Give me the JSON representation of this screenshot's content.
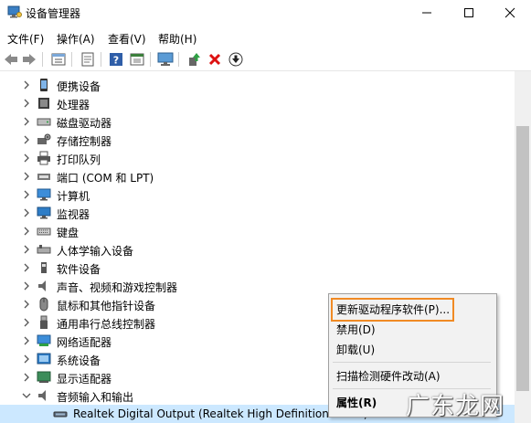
{
  "window": {
    "title": "设备管理器"
  },
  "menu": [
    "文件(F)",
    "操作(A)",
    "查看(V)",
    "帮助(H)"
  ],
  "toolbar_icons": [
    "back-icon",
    "forward-icon",
    "properties-icon",
    "show-hidden-icon",
    "help-icon",
    "view-icon",
    "scan-monitor-icon",
    "update-driver-icon",
    "uninstall-icon",
    "disable-icon"
  ],
  "tree": {
    "items": [
      "便携设备",
      "处理器",
      "磁盘驱动器",
      "存储控制器",
      "打印队列",
      "端口 (COM 和 LPT)",
      "计算机",
      "监视器",
      "键盘",
      "人体学输入设备",
      "软件设备",
      "声音、视频和游戏控制器",
      "鼠标和其他指针设备",
      "通用串行总线控制器",
      "网络适配器",
      "系统设备",
      "显示适配器",
      "音频输入和输出"
    ],
    "child": "Realtek Digital Output (Realtek High Definition Audio)"
  },
  "context_menu": {
    "update": "更新驱动程序软件(P)...",
    "disable": "禁用(D)",
    "uninstall": "卸载(U)",
    "scan": "扫描检测硬件改动(A)",
    "properties": "属性(R)"
  },
  "watermark": "广东龙网"
}
